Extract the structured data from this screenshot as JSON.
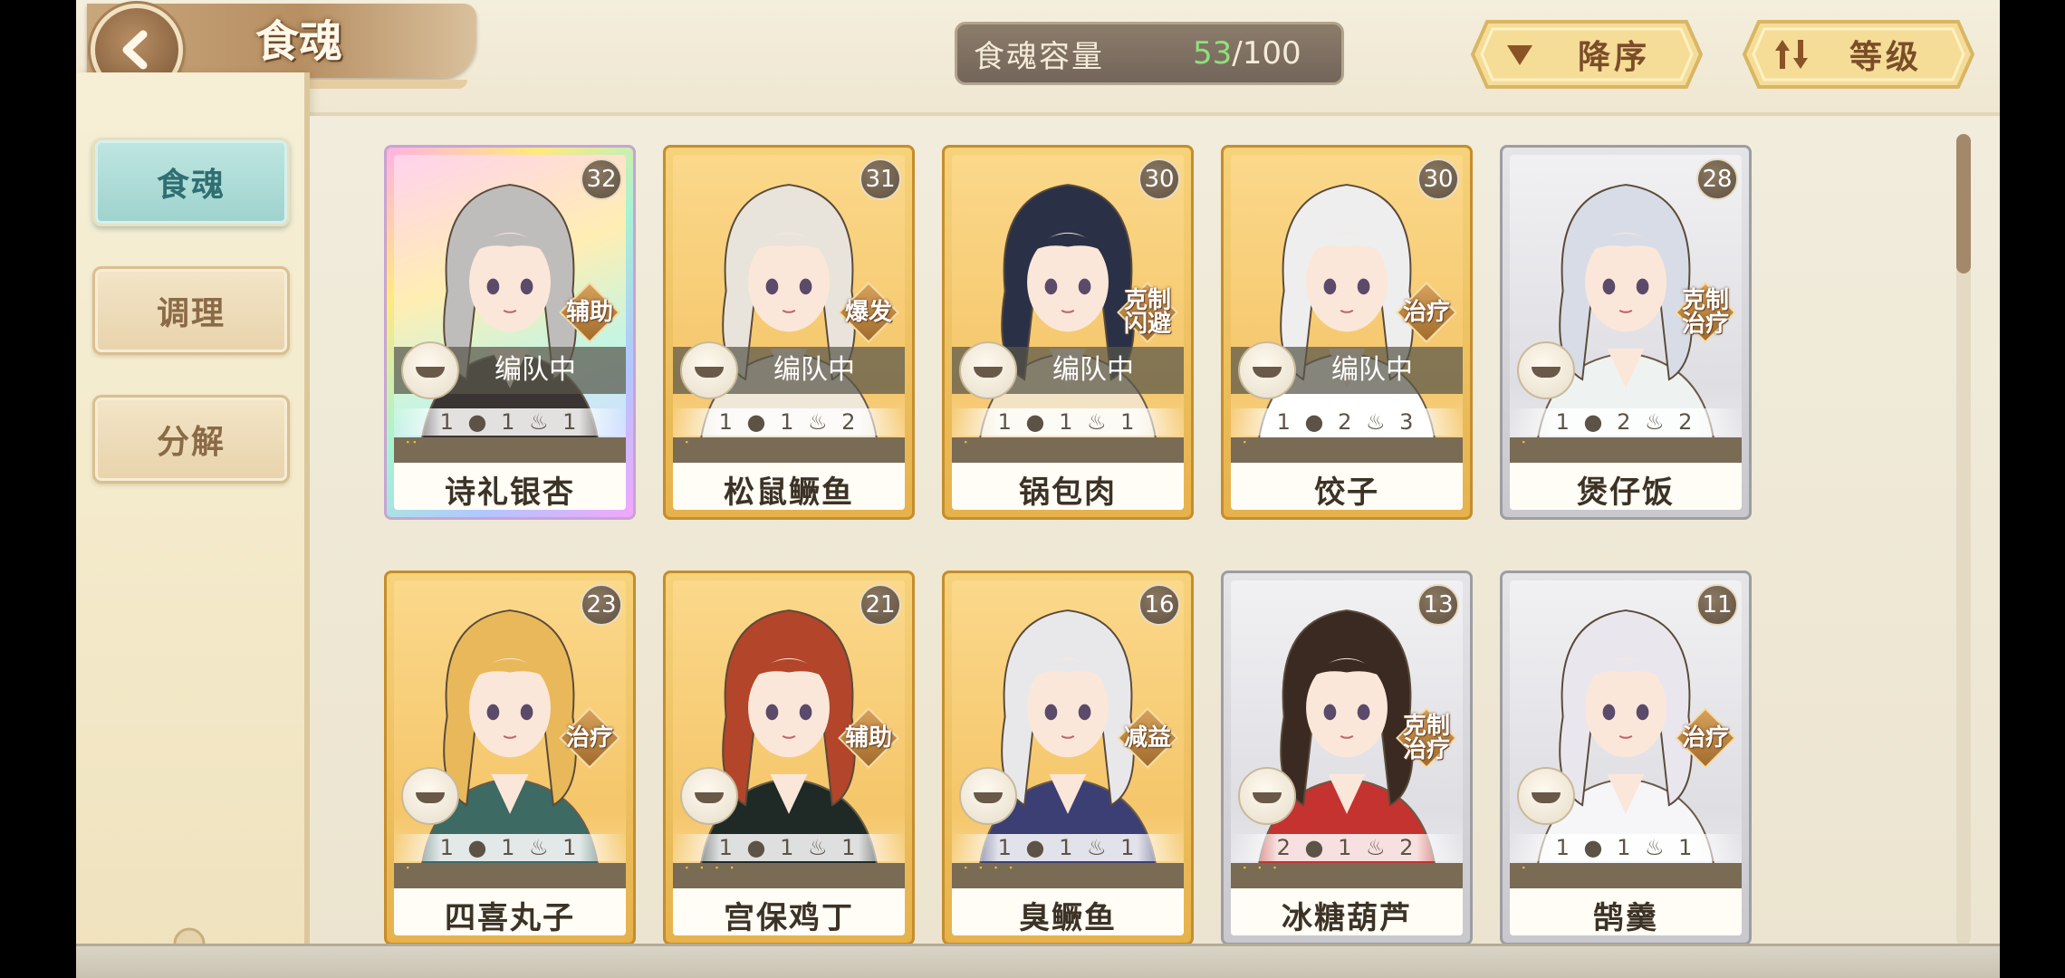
{
  "header": {
    "title": "食魂",
    "capacity_label": "食魂容量",
    "capacity_current": "53",
    "capacity_max": "/100",
    "sort_order_label": "降序",
    "sort_field_label": "等级"
  },
  "sidebar": {
    "items": [
      {
        "label": "食魂",
        "active": true
      },
      {
        "label": "调理",
        "active": false
      },
      {
        "label": "分解",
        "active": false
      }
    ]
  },
  "colors": {
    "accent_teal": "#9fd2cd",
    "capacity_current": "#8fe07d",
    "card_gold": "#f5c66a",
    "card_silver": "#dedee3"
  },
  "cards": [
    {
      "name": "诗礼银杏",
      "level": "32",
      "role": "辅助",
      "in_team": true,
      "team_text": "编队中",
      "stats": "1 1 1",
      "frame": "rainbow",
      "flames": "ᐝᐝ"
    },
    {
      "name": "松鼠鳜鱼",
      "level": "31",
      "role": "爆发",
      "in_team": true,
      "team_text": "编队中",
      "stats": "1 1 2",
      "frame": "gold",
      "flames": "ᐝ"
    },
    {
      "name": "锅包肉",
      "level": "30",
      "role": "克制\n闪避",
      "in_team": true,
      "team_text": "编队中",
      "stats": "1 1 1",
      "frame": "gold",
      "flames": "ᐝ"
    },
    {
      "name": "饺子",
      "level": "30",
      "role": "治疗",
      "in_team": true,
      "team_text": "编队中",
      "stats": "1 2 3",
      "frame": "gold",
      "flames": "ᐝ"
    },
    {
      "name": "煲仔饭",
      "level": "28",
      "role": "克制\n治疗",
      "in_team": false,
      "team_text": "",
      "stats": "1 2 2",
      "frame": "silver",
      "flames": "ᐝ"
    },
    {
      "name": "四喜丸子",
      "level": "23",
      "role": "治疗",
      "in_team": false,
      "team_text": "",
      "stats": "1 1 1",
      "frame": "gold",
      "flames": "ᐝ"
    },
    {
      "name": "宫保鸡丁",
      "level": "21",
      "role": "辅助",
      "in_team": false,
      "team_text": "",
      "stats": "1 1 1",
      "frame": "gold",
      "flames": "ᐝ ᐝ ᐝ ᐝ"
    },
    {
      "name": "臭鳜鱼",
      "level": "16",
      "role": "减益",
      "in_team": false,
      "team_text": "",
      "stats": "1 1 1",
      "frame": "gold",
      "flames": "ᐝ ᐝ ᐝ ᐝ"
    },
    {
      "name": "冰糖葫芦",
      "level": "13",
      "role": "克制\n治疗",
      "in_team": false,
      "team_text": "",
      "stats": "2 1 2",
      "frame": "silver",
      "flames": "ᐝ ᐝ ᐝ"
    },
    {
      "name": "鹄羹",
      "level": "11",
      "role": "治疗",
      "in_team": false,
      "team_text": "",
      "stats": "1 1 1",
      "frame": "silver",
      "flames": "ᐝ"
    }
  ]
}
